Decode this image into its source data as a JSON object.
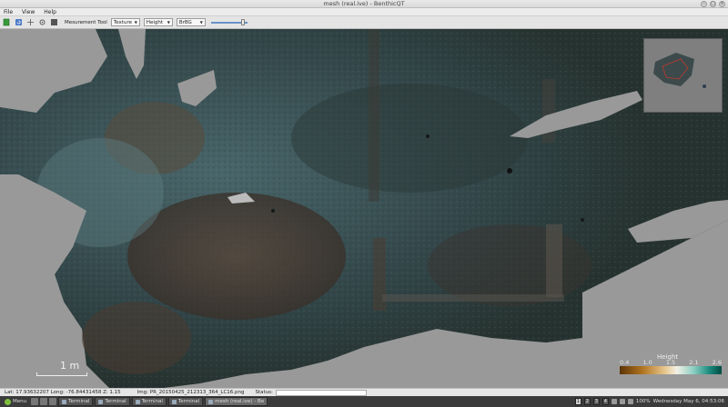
{
  "window": {
    "title": "mesh (real.ive) - BenthicQT"
  },
  "menu": [
    "File",
    "View",
    "Help"
  ],
  "toolbar": {
    "measurement_label": "Mesurement Tool",
    "texture_select": "Texture",
    "height_select": "Height",
    "colormap_select": "BrBG",
    "slider_level": 0.92,
    "icons": [
      "folder-green-icon",
      "reload-icon",
      "crosshair-icon",
      "gear-icon",
      "layers-icon"
    ]
  },
  "overlay": {
    "scale_label": "1 m",
    "legend_title": "Height",
    "legend_ticks": [
      "0.4",
      "1.0",
      "1.5",
      "2.1",
      "2.6"
    ]
  },
  "status": {
    "coords": "Lat: 17.93632207 Long: -76.84431458 Z: 1.15",
    "image": "Img: PR_20150425_212313_364_LC16.png",
    "status_label": "Status:"
  },
  "taskbar": {
    "menu_label": "Menu",
    "tasks": [
      "Terminal",
      "Terminal",
      "Terminal",
      "Terminal",
      "mesh (real.ive) - Be"
    ],
    "workspaces": [
      "1",
      "2",
      "3",
      "4"
    ],
    "battery": "100%",
    "clock": "Wednesday May 6, 04:53:06"
  },
  "colors": {
    "mesh_dark": "#2b3a3c",
    "mesh_teal": "#3f5a5e",
    "mesh_brown": "#4a3a30",
    "background": "#999999"
  }
}
